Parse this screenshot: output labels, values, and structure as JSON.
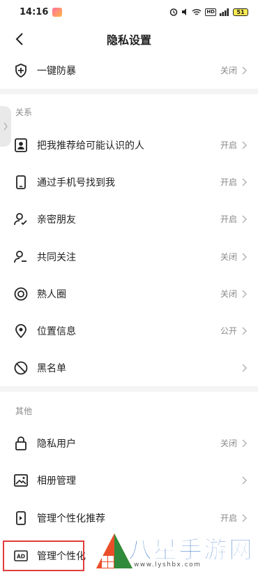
{
  "status_bar": {
    "time": "14:16",
    "battery": "51"
  },
  "nav": {
    "title": "隐私设置"
  },
  "top_item": {
    "label": "一键防暴",
    "value": "关闭"
  },
  "sections": {
    "relations": "关系",
    "other": "其他"
  },
  "relation_items": [
    {
      "label": "把我推荐给可能认识的人",
      "value": "开启",
      "icon": "contact-card-icon"
    },
    {
      "label": "通过手机号找到我",
      "value": "开启",
      "icon": "phone-icon"
    },
    {
      "label": "亲密朋友",
      "value": "开启",
      "icon": "close-friends-icon"
    },
    {
      "label": "共同关注",
      "value": "关闭",
      "icon": "mutual-follow-icon"
    },
    {
      "label": "熟人圈",
      "value": "关闭",
      "icon": "circle-icon"
    },
    {
      "label": "位置信息",
      "value": "公开",
      "icon": "location-pin-icon"
    },
    {
      "label": "黑名单",
      "value": "",
      "icon": "block-icon"
    }
  ],
  "other_items": [
    {
      "label": "隐私用户",
      "value": "关闭",
      "icon": "lock-icon"
    },
    {
      "label": "相册管理",
      "value": "",
      "icon": "image-icon"
    },
    {
      "label": "管理个性化推荐",
      "value": "开启",
      "icon": "phone-recommend-icon"
    },
    {
      "label": "管理个性化",
      "value": "",
      "icon": "ad-icon"
    }
  ],
  "watermark": {
    "title": "八星手游网",
    "url": "www.lyshbx.com"
  }
}
